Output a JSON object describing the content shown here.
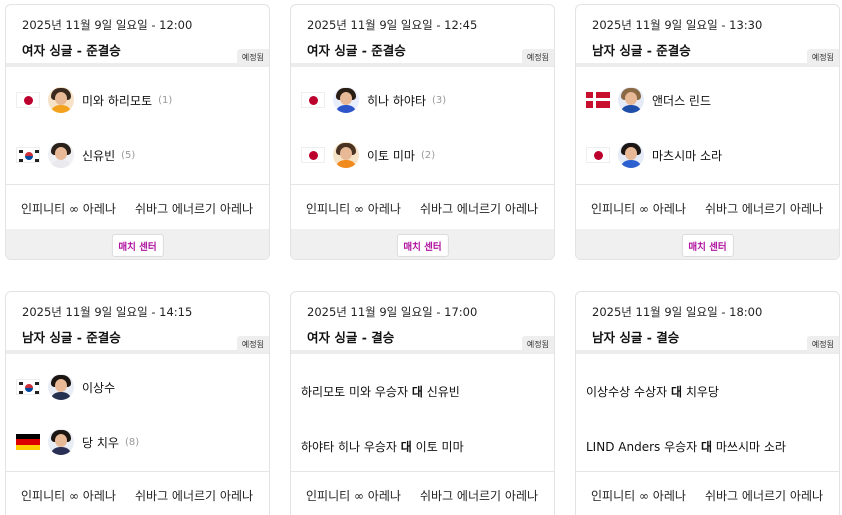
{
  "badge_label": "예정됨",
  "match_center_label": "매치 센터",
  "venues": [
    "인피니티 ∞ 아레나",
    "쉬바그 에너르기 아레나"
  ],
  "vs_word": "대",
  "colors": {
    "accent": "#b0139f",
    "badge_bg": "#eeeeee",
    "panel_bg": "#f0f0f0"
  },
  "cards": [
    {
      "date": "2025년 11월 9일 일요일 - 12:00",
      "event": "여자 싱글 - 준결승",
      "players": [
        {
          "flag": "japan-flag",
          "name": "미와 하리모토",
          "seed": "(1)"
        },
        {
          "flag": "korea-flag",
          "name": "신유빈",
          "seed": "(5)"
        }
      ]
    },
    {
      "date": "2025년 11월 9일 일요일 - 12:45",
      "event": "여자 싱글 - 준결승",
      "players": [
        {
          "flag": "japan-flag",
          "name": "히나 하야타",
          "seed": "(3)"
        },
        {
          "flag": "japan-flag",
          "name": "이토 미마",
          "seed": "(2)"
        }
      ]
    },
    {
      "date": "2025년 11월 9일 일요일 - 13:30",
      "event": "남자 싱글 - 준결승",
      "players": [
        {
          "flag": "denmark-flag",
          "name": "앤더스 린드",
          "seed": ""
        },
        {
          "flag": "japan-flag",
          "name": "마츠시마 소라",
          "seed": ""
        }
      ]
    },
    {
      "date": "2025년 11월 9일 일요일 - 14:15",
      "event": "남자 싱글 - 준결승",
      "players": [
        {
          "flag": "korea-flag",
          "name": "이상수",
          "seed": ""
        },
        {
          "flag": "germany-flag",
          "name": "당 치우",
          "seed": "(8)"
        }
      ]
    },
    {
      "date": "2025년 11월 9일 일요일 - 17:00",
      "event": "여자 싱글 - 결승",
      "matchups": [
        {
          "left": "하리모토 미와 우승자",
          "right": "신유빈"
        },
        {
          "left": "하야타 히나 우승자",
          "right": "이토 미마"
        }
      ]
    },
    {
      "date": "2025년 11월 9일 일요일 - 18:00",
      "event": "남자 싱글 - 결승",
      "matchups": [
        {
          "left": "이상수상 수상자",
          "right": "치우당"
        },
        {
          "left": "LIND Anders 우승자",
          "right": "마쓰시마 소라"
        }
      ]
    }
  ]
}
